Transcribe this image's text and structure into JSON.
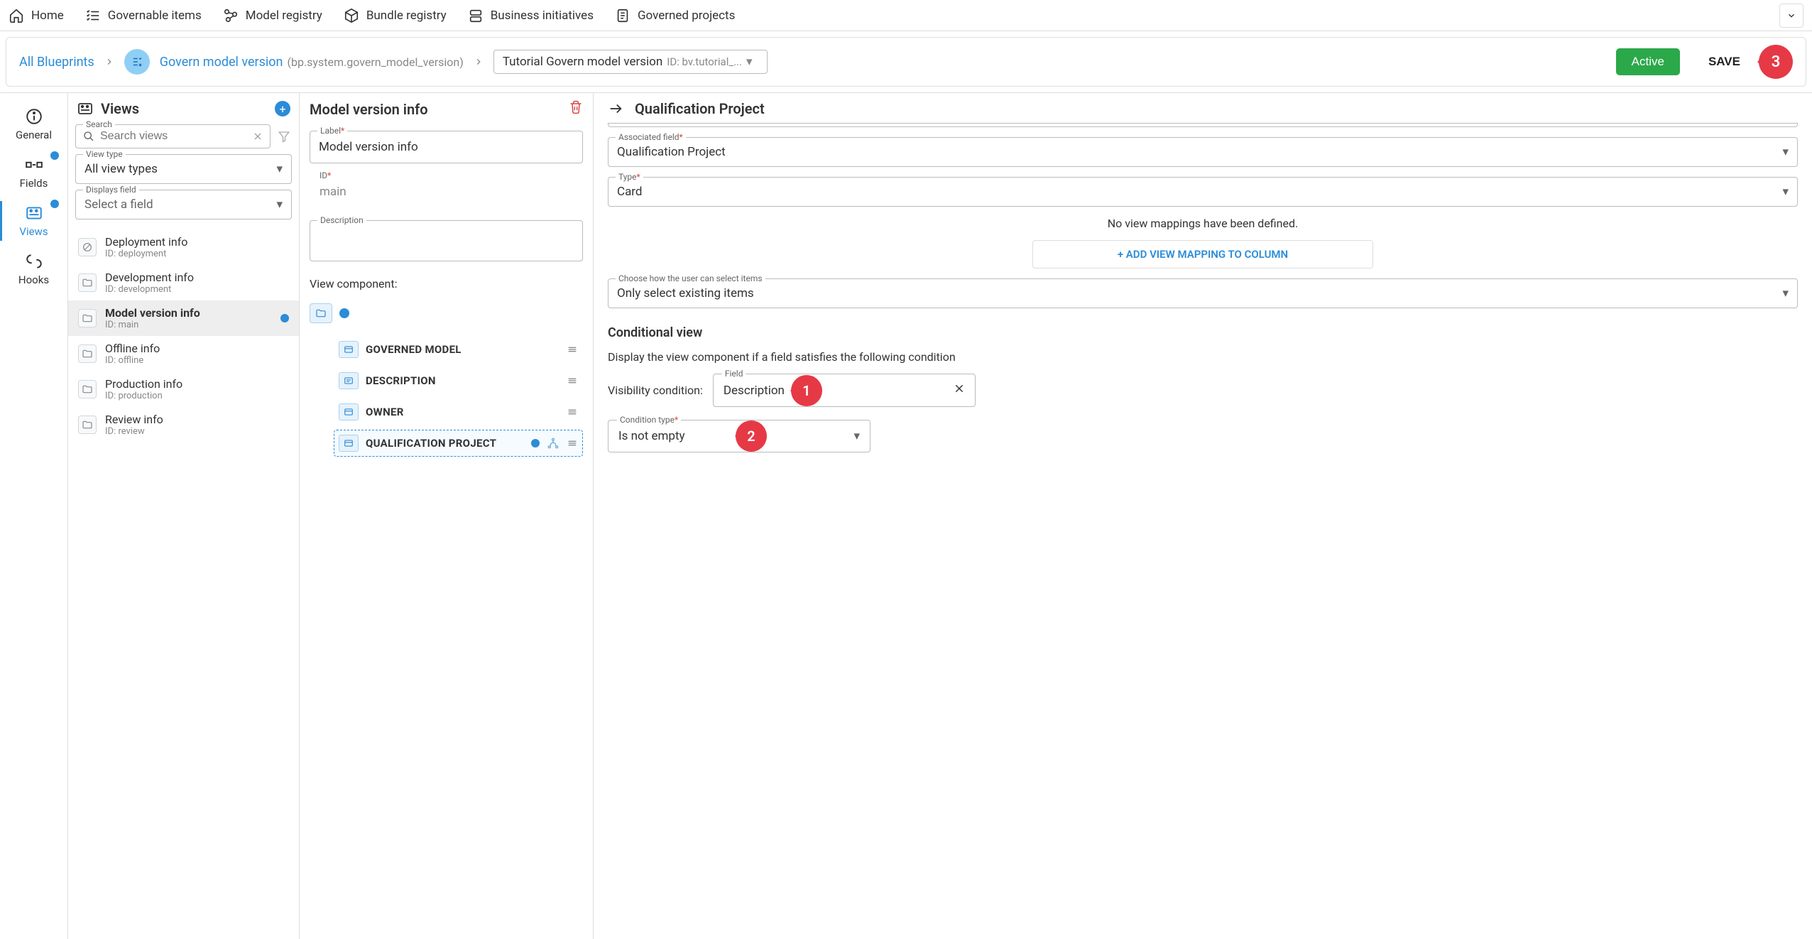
{
  "topnav": {
    "items": [
      {
        "label": "Home"
      },
      {
        "label": "Governable items"
      },
      {
        "label": "Model registry"
      },
      {
        "label": "Bundle registry"
      },
      {
        "label": "Business initiatives"
      },
      {
        "label": "Governed projects"
      }
    ]
  },
  "breadcrumb": {
    "root": "All Blueprints",
    "blueprint_name": "Govern model version",
    "blueprint_id": "(bp.system.govern_model_version)",
    "version_name": "Tutorial Govern model version",
    "version_id": "ID: bv.tutorial_...",
    "active_label": "Active",
    "save_label": "SAVE",
    "save_callout": "3"
  },
  "side_tabs": {
    "general": "General",
    "fields": "Fields",
    "views": "Views",
    "hooks": "Hooks"
  },
  "views_panel": {
    "title": "Views",
    "search_legend": "Search",
    "search_placeholder": "Search views",
    "viewtype_legend": "View type",
    "viewtype_value": "All view types",
    "displays_legend": "Displays field",
    "displays_value": "Select a field",
    "list": [
      {
        "name": "Deployment info",
        "id": "ID: deployment"
      },
      {
        "name": "Development info",
        "id": "ID: development"
      },
      {
        "name": "Model version info",
        "id": "ID: main"
      },
      {
        "name": "Offline info",
        "id": "ID: offline"
      },
      {
        "name": "Production info",
        "id": "ID: production"
      },
      {
        "name": "Review info",
        "id": "ID: review"
      }
    ]
  },
  "middle": {
    "title": "Model version info",
    "label_legend": "Label",
    "label_value": "Model version info",
    "id_legend": "ID",
    "id_value": "main",
    "desc_legend": "Description",
    "vc_label": "View component:",
    "components": [
      {
        "label": "GOVERNED MODEL"
      },
      {
        "label": "DESCRIPTION"
      },
      {
        "label": "OWNER"
      },
      {
        "label": "QUALIFICATION PROJECT"
      }
    ]
  },
  "right": {
    "title": "Qualification Project",
    "assoc_legend": "Associated field",
    "assoc_value": "Qualification Project",
    "type_legend": "Type",
    "type_value": "Card",
    "mapping_msg": "No view mappings have been defined.",
    "mapping_btn": "+ ADD VIEW MAPPING TO COLUMN",
    "select_legend": "Choose how the user can select items",
    "select_value": "Only select existing items",
    "cond_title": "Conditional view",
    "cond_desc": "Display the view component if a field satisfies the following condition",
    "vis_label": "Visibility condition:",
    "field_legend": "Field",
    "field_value": "Description",
    "field_callout": "1",
    "condtype_legend": "Condition type",
    "condtype_value": "Is not empty",
    "condtype_callout": "2"
  }
}
